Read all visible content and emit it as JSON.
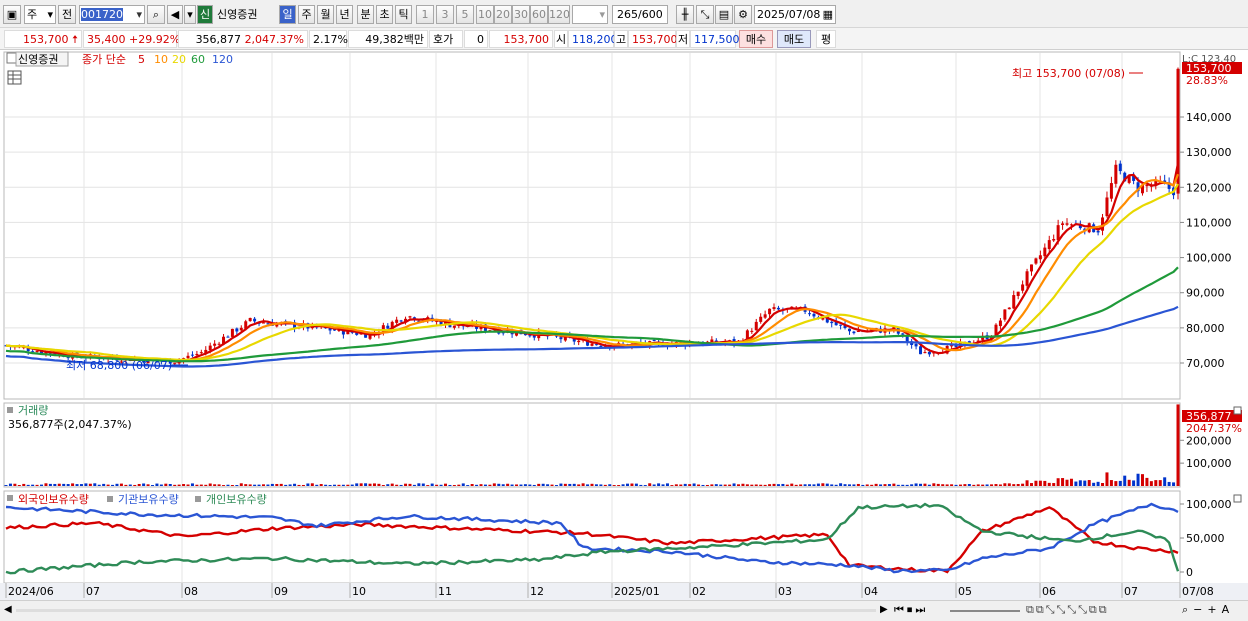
{
  "toolbar": {
    "period_type": "주",
    "prev_label": "전",
    "code": "001720",
    "credit_tag": "신",
    "stock_name": "신영증권",
    "periods": [
      "일",
      "주",
      "월",
      "년",
      "분",
      "초",
      "틱"
    ],
    "active_period": "일",
    "intervals": [
      "1",
      "3",
      "5",
      "10",
      "20",
      "30",
      "60",
      "120"
    ],
    "count_value": "265",
    "count_max": "/600",
    "date": "2025/07/08"
  },
  "info": {
    "price": "153,700",
    "change": "35,400",
    "change_pct": "+29.92%",
    "volume": "356,877",
    "volume_pct": "2,047.37%",
    "turnover_pct": "2.17%",
    "amount": "49,382백만",
    "hoga_label": "호가",
    "hoga_value": "0",
    "hoga_price": "153,700",
    "open_label": "시",
    "open": "118,200",
    "high_label": "고",
    "high": "153,700",
    "low_label": "저",
    "low": "117,500",
    "buy_label": "매수",
    "sell_label": "매도",
    "avg_label": "평"
  },
  "price_panel": {
    "name_tag": "신영증권",
    "ma_label": "종가 단순",
    "ma_periods": [
      "5",
      "10",
      "20",
      "60",
      "120"
    ],
    "ma_colors": [
      "#d40000",
      "#ff8c00",
      "#e8d800",
      "#1f9a3a",
      "#2a55d4"
    ],
    "ratio_label": "L:C 123.40",
    "current_tag": "153,700",
    "current_pct": "28.83%",
    "high_annotation": "최고 153,700 (07/08)",
    "low_annotation": "최저 68,800 (06/07)",
    "y_ticks": [
      "140,000",
      "130,000",
      "120,000",
      "110,000",
      "100,000",
      "90,000",
      "80,000",
      "70,000"
    ]
  },
  "volume_panel": {
    "title": "거래량",
    "subtitle": "356,877주(2,047.37%)",
    "current_tag": "356,877",
    "current_pct": "2047.37%",
    "y_ticks": [
      "200,000",
      "100,000"
    ]
  },
  "holding_panel": {
    "series": [
      {
        "label": "외국인보유수량",
        "color": "#d40000"
      },
      {
        "label": "기관보유수량",
        "color": "#2a55d4"
      },
      {
        "label": "개인보유수량",
        "color": "#2e8b57"
      }
    ],
    "y_ticks": [
      "100,000",
      "50,000",
      "0"
    ]
  },
  "x_axis": [
    "2024/06",
    "07",
    "08",
    "09",
    "10",
    "11",
    "12",
    "2025/01",
    "02",
    "03",
    "04",
    "05",
    "06",
    "07",
    "07/08"
  ],
  "colors": {
    "up": "#d40000",
    "down": "#0033cc",
    "grid": "#e0e0e0"
  }
}
